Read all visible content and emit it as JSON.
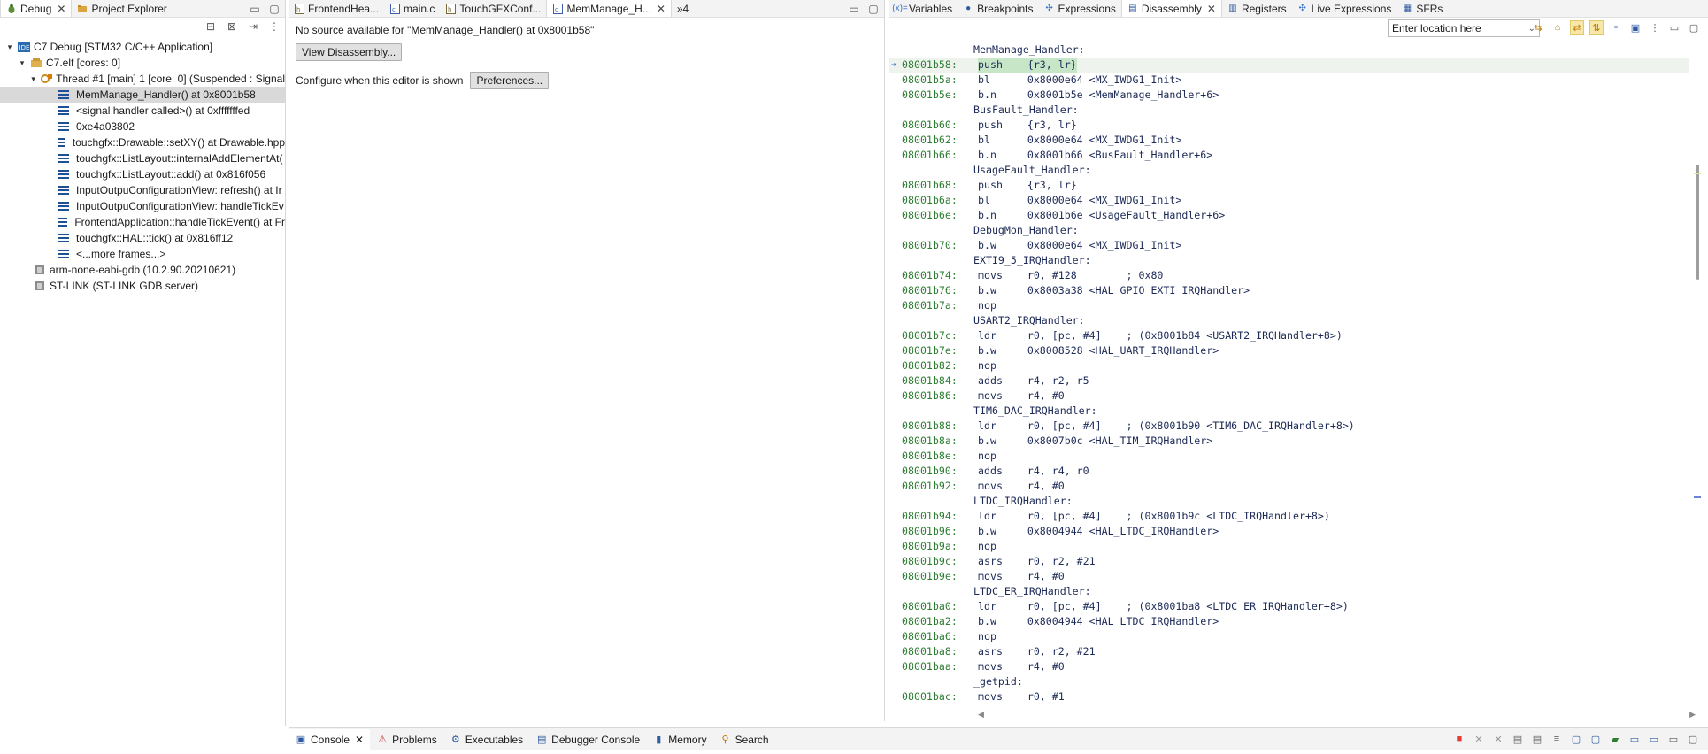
{
  "debug_view": {
    "tabs": [
      {
        "label": "Debug",
        "icon": "bug-icon",
        "active": true,
        "closable": true
      },
      {
        "label": "Project Explorer",
        "icon": "folder-icon",
        "active": false,
        "closable": false
      }
    ],
    "tree": {
      "launch": "C7 Debug [STM32 C/C++ Application]",
      "elf": "C7.elf [cores: 0]",
      "thread": "Thread #1 [main] 1 [core: 0] (Suspended : Signal",
      "frames": [
        "MemManage_Handler() at 0x8001b58",
        "<signal handler called>() at 0xfffffffed",
        "0xe4a03802",
        "touchgfx::Drawable::setXY() at Drawable.hpp",
        "touchgfx::ListLayout::internalAddElementAt(",
        "touchgfx::ListLayout::add() at 0x816f056",
        "InputOutpuConfigurationView::refresh() at Ir",
        "InputOutpuConfigurationView::handleTickEv",
        "FrontendApplication::handleTickEvent() at Fr",
        "touchgfx::HAL::tick() at 0x816ff12",
        "<...more frames...>"
      ],
      "gdb": "arm-none-eabi-gdb (10.2.90.20210621)",
      "stlink": "ST-LINK (ST-LINK GDB server)"
    }
  },
  "editor": {
    "tabs": [
      {
        "label": "FrontendHea...",
        "active": false
      },
      {
        "label": "main.c",
        "active": false
      },
      {
        "label": "TouchGFXConf...",
        "active": false
      },
      {
        "label": "MemManage_H...",
        "active": true
      }
    ],
    "overflow": "»4",
    "message": "No source available for \"MemManage_Handler() at 0x8001b58\"",
    "view_disassembly": "View Disassembly...",
    "configure_text": "Configure when this editor is shown",
    "preferences": "Preferences..."
  },
  "disassembly": {
    "tabs": [
      {
        "label": "Variables",
        "icon": "variables-icon"
      },
      {
        "label": "Breakpoints",
        "icon": "breakpoints-icon"
      },
      {
        "label": "Expressions",
        "icon": "expressions-icon"
      },
      {
        "label": "Disassembly",
        "icon": "disassembly-icon",
        "active": true
      },
      {
        "label": "Registers",
        "icon": "registers-icon"
      },
      {
        "label": "Live Expressions",
        "icon": "live-expressions-icon"
      },
      {
        "label": "SFRs",
        "icon": "sfrs-icon"
      }
    ],
    "location_placeholder": "Enter location here",
    "lines": [
      {
        "label": "MemManage_Handler:"
      },
      {
        "addr": "08001b58:",
        "instr": "push    {r3, lr}",
        "current": true
      },
      {
        "addr": "08001b5a:",
        "instr": "bl      0x8000e64 <MX_IWDG1_Init>"
      },
      {
        "addr": "08001b5e:",
        "instr": "b.n     0x8001b5e <MemManage_Handler+6>"
      },
      {
        "label": "BusFault_Handler:"
      },
      {
        "addr": "08001b60:",
        "instr": "push    {r3, lr}"
      },
      {
        "addr": "08001b62:",
        "instr": "bl      0x8000e64 <MX_IWDG1_Init>"
      },
      {
        "addr": "08001b66:",
        "instr": "b.n     0x8001b66 <BusFault_Handler+6>"
      },
      {
        "label": "UsageFault_Handler:"
      },
      {
        "addr": "08001b68:",
        "instr": "push    {r3, lr}"
      },
      {
        "addr": "08001b6a:",
        "instr": "bl      0x8000e64 <MX_IWDG1_Init>"
      },
      {
        "addr": "08001b6e:",
        "instr": "b.n     0x8001b6e <UsageFault_Handler+6>"
      },
      {
        "label": "DebugMon_Handler:"
      },
      {
        "addr": "08001b70:",
        "instr": "b.w     0x8000e64 <MX_IWDG1_Init>"
      },
      {
        "label": "EXTI9_5_IRQHandler:"
      },
      {
        "addr": "08001b74:",
        "instr": "movs    r0, #128        ; 0x80"
      },
      {
        "addr": "08001b76:",
        "instr": "b.w     0x8003a38 <HAL_GPIO_EXTI_IRQHandler>"
      },
      {
        "addr": "08001b7a:",
        "instr": "nop"
      },
      {
        "label": "USART2_IRQHandler:"
      },
      {
        "addr": "08001b7c:",
        "instr": "ldr     r0, [pc, #4]    ; (0x8001b84 <USART2_IRQHandler+8>)"
      },
      {
        "addr": "08001b7e:",
        "instr": "b.w     0x8008528 <HAL_UART_IRQHandler>"
      },
      {
        "addr": "08001b82:",
        "instr": "nop"
      },
      {
        "addr": "08001b84:",
        "instr": "adds    r4, r2, r5"
      },
      {
        "addr": "08001b86:",
        "instr": "movs    r4, #0"
      },
      {
        "label": "TIM6_DAC_IRQHandler:"
      },
      {
        "addr": "08001b88:",
        "instr": "ldr     r0, [pc, #4]    ; (0x8001b90 <TIM6_DAC_IRQHandler+8>)"
      },
      {
        "addr": "08001b8a:",
        "instr": "b.w     0x8007b0c <HAL_TIM_IRQHandler>"
      },
      {
        "addr": "08001b8e:",
        "instr": "nop"
      },
      {
        "addr": "08001b90:",
        "instr": "adds    r4, r4, r0"
      },
      {
        "addr": "08001b92:",
        "instr": "movs    r4, #0"
      },
      {
        "label": "LTDC_IRQHandler:"
      },
      {
        "addr": "08001b94:",
        "instr": "ldr     r0, [pc, #4]    ; (0x8001b9c <LTDC_IRQHandler+8>)"
      },
      {
        "addr": "08001b96:",
        "instr": "b.w     0x8004944 <HAL_LTDC_IRQHandler>"
      },
      {
        "addr": "08001b9a:",
        "instr": "nop"
      },
      {
        "addr": "08001b9c:",
        "instr": "asrs    r0, r2, #21"
      },
      {
        "addr": "08001b9e:",
        "instr": "movs    r4, #0"
      },
      {
        "label": "LTDC_ER_IRQHandler:"
      },
      {
        "addr": "08001ba0:",
        "instr": "ldr     r0, [pc, #4]    ; (0x8001ba8 <LTDC_ER_IRQHandler+8>)"
      },
      {
        "addr": "08001ba2:",
        "instr": "b.w     0x8004944 <HAL_LTDC_IRQHandler>"
      },
      {
        "addr": "08001ba6:",
        "instr": "nop"
      },
      {
        "addr": "08001ba8:",
        "instr": "asrs    r0, r2, #21"
      },
      {
        "addr": "08001baa:",
        "instr": "movs    r4, #0"
      },
      {
        "label": "_getpid:"
      },
      {
        "addr": "08001bac:",
        "instr": "movs    r0, #1"
      }
    ]
  },
  "bottom": {
    "tabs": [
      {
        "label": "Console",
        "icon": "console-icon",
        "active": true,
        "closable": true
      },
      {
        "label": "Problems",
        "icon": "problems-icon"
      },
      {
        "label": "Executables",
        "icon": "executables-icon"
      },
      {
        "label": "Debugger Console",
        "icon": "debugger-console-icon"
      },
      {
        "label": "Memory",
        "icon": "memory-icon"
      },
      {
        "label": "Search",
        "icon": "search-icon"
      }
    ]
  },
  "colors": {
    "address": "#2e7d32",
    "instruction": "#1d2a57",
    "current_line": "#c7e6c7",
    "terminate": "#e53935"
  }
}
